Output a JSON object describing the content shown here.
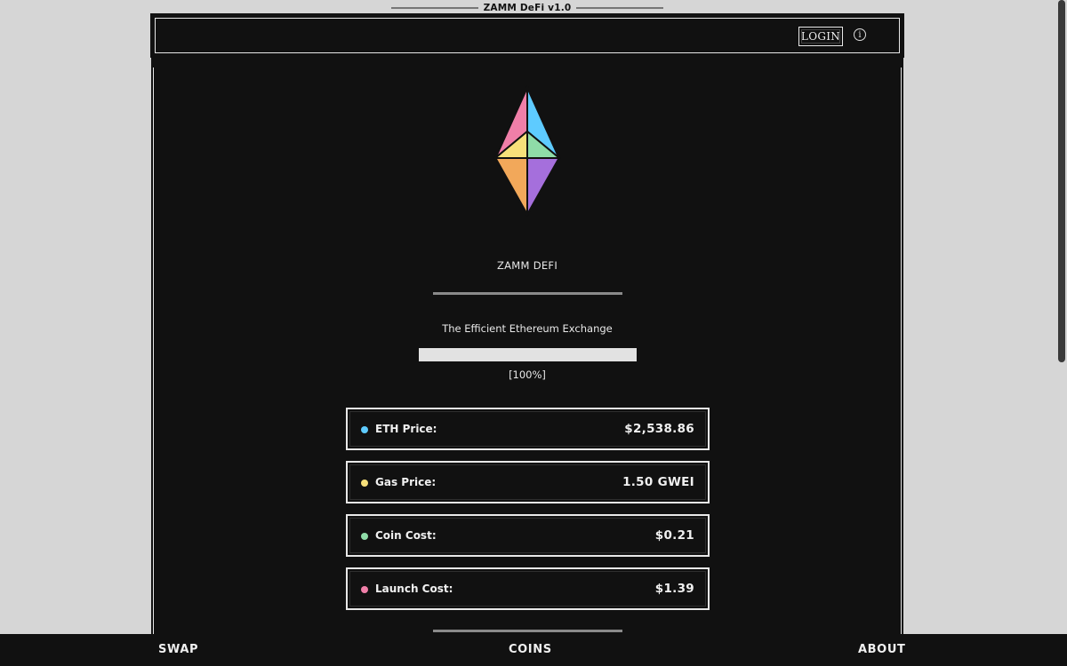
{
  "window": {
    "title": "ZAMM DeFi v1.0"
  },
  "header": {
    "login_label": "LOGIN",
    "info_icon": "info-icon",
    "info_glyph": "i"
  },
  "hero": {
    "logo_icon": "ethereum-diamond-icon",
    "logo_colors": [
      "#f07fa8",
      "#5ecbff",
      "#f7e07a",
      "#8fdca8",
      "#f2a85a",
      "#a56fdc"
    ],
    "app_name": "ZAMM DEFI",
    "tagline": "The Efficient Ethereum Exchange",
    "progress_fraction": 1.0,
    "progress_text": "[100%]"
  },
  "stats": [
    {
      "label": "ETH Price:",
      "value": "$2,538.86",
      "dot_color": "#5ecbff"
    },
    {
      "label": "Gas Price:",
      "value": "1.50 GWEI",
      "dot_color": "#f7e07a"
    },
    {
      "label": "Coin Cost:",
      "value": "$0.21",
      "dot_color": "#8fdca8"
    },
    {
      "label": "Launch Cost:",
      "value": "$1.39",
      "dot_color": "#f07fa8"
    }
  ],
  "bottom_nav": {
    "items": [
      {
        "label": "SWAP"
      },
      {
        "label": "COINS"
      },
      {
        "label": "ABOUT"
      }
    ]
  }
}
